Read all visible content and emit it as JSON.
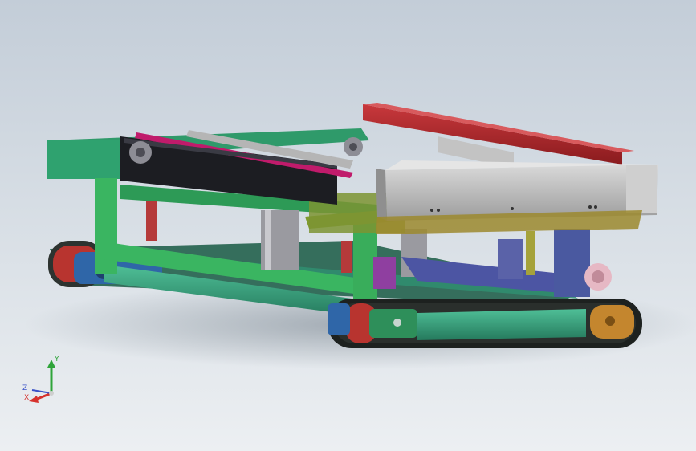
{
  "viewport": {
    "background_top": "#c3cdd8",
    "background_bottom": "#eceff2"
  },
  "model": {
    "component_colors": {
      "track": "#2a2f2c",
      "track_frame": "#3aa37f",
      "chassis": "#34b06a",
      "lift_frame": "#7f9a2e",
      "conveyor_belt": "#1c1d22",
      "conveyor_rail": "#c01b6b",
      "top_beam": "#c0282e",
      "box_beam": "#bdbdbd",
      "motor": "#2f66a8",
      "base_plate": "#4c55a3",
      "cylinder": "#9a9aa0",
      "pivot": "#b53a3a"
    }
  },
  "triad": {
    "x_color": "#d6322d",
    "y_color": "#2fa43a",
    "z_color": "#3a52c8",
    "labels": {
      "x": "X",
      "y": "Y",
      "z": "Z"
    }
  }
}
